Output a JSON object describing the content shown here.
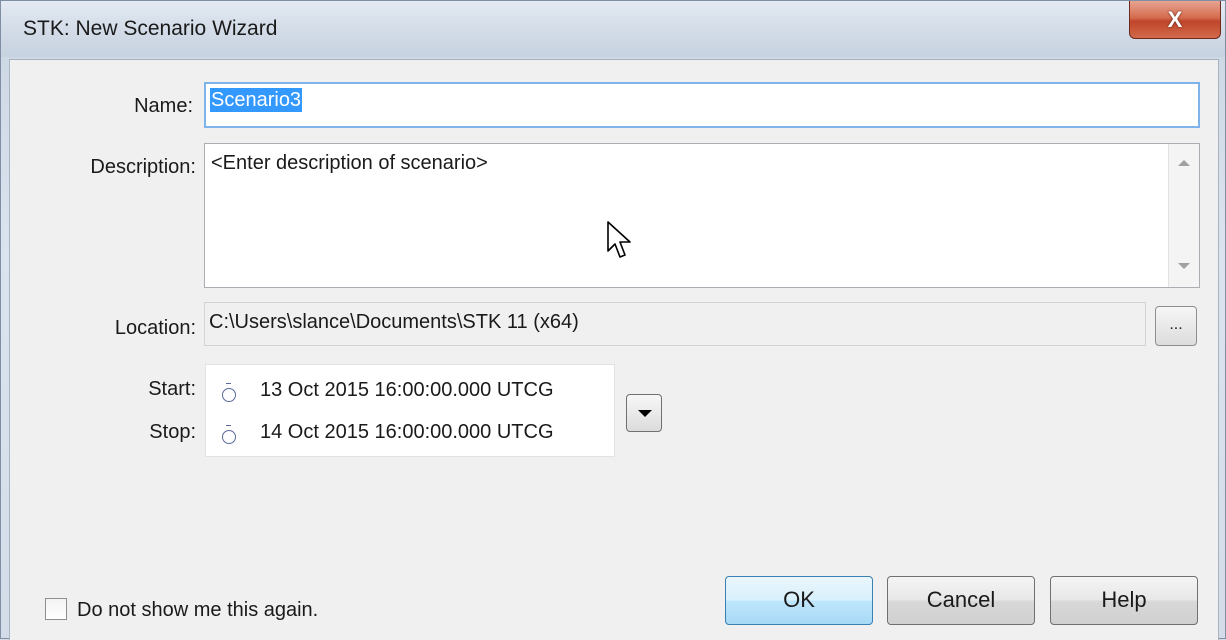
{
  "window": {
    "title": "STK: New Scenario Wizard",
    "close_glyph": "X"
  },
  "form": {
    "name_label": "Name:",
    "name_value": "Scenario3",
    "description_label": "Description:",
    "description_value": "<Enter description of scenario>",
    "location_label": "Location:",
    "location_value": "C:\\Users\\slance\\Documents\\STK 11 (x64)",
    "browse_label": "...",
    "start_label": "Start:",
    "start_value": "13 Oct 2015 16:00:00.000 UTCG",
    "stop_label": "Stop:",
    "stop_value": "14 Oct 2015 16:00:00.000 UTCG"
  },
  "footer": {
    "checkbox_label": "Do not show me this again.",
    "checkbox_checked": false,
    "ok_label": "OK",
    "cancel_label": "Cancel",
    "help_label": "Help"
  },
  "icons": {
    "close": "close-icon",
    "clock": "clock-icon",
    "dropdown": "triangle-down-icon",
    "cursor": "mouse-pointer-icon"
  }
}
